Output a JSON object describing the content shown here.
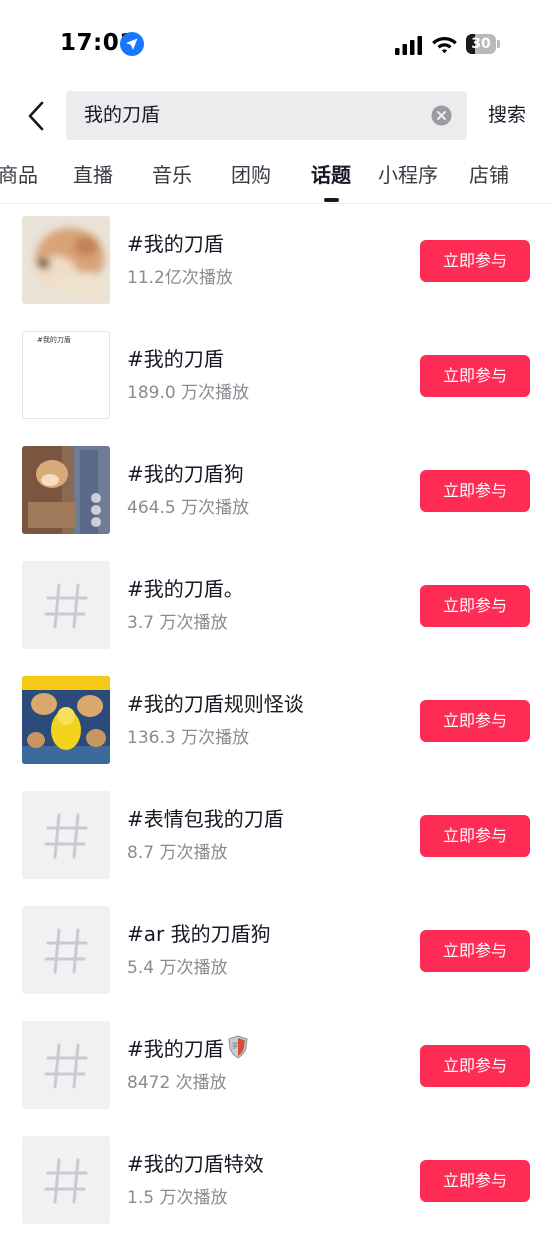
{
  "status_bar": {
    "time": "17:01",
    "battery": "30",
    "battery_level_percent": 30
  },
  "search": {
    "query": "我的刀盾",
    "submit_label": "搜索"
  },
  "tabs": [
    {
      "label": "商品"
    },
    {
      "label": "直播"
    },
    {
      "label": "音乐"
    },
    {
      "label": "团购"
    },
    {
      "label": "话题",
      "active": true
    },
    {
      "label": "小程序"
    },
    {
      "label": "店铺"
    }
  ],
  "topics": [
    {
      "title": "#我的刀盾",
      "plays": "11.2亿次播放",
      "thumb": "doge-blur-image",
      "action": "立即参与"
    },
    {
      "title": "#我的刀盾",
      "plays": "189.0 万次播放",
      "thumb": "blank-text-image",
      "thumb_text": "#我的刀盾",
      "action": "立即参与"
    },
    {
      "title": "#我的刀盾狗",
      "plays": "464.5 万次播放",
      "thumb": "dog-video-still",
      "action": "立即参与"
    },
    {
      "title": "#我的刀盾。",
      "plays": "3.7 万次播放",
      "thumb": "hash-icon",
      "action": "立即参与"
    },
    {
      "title": "#我的刀盾规则怪谈",
      "plays": "136.3 万次播放",
      "thumb": "game-cartoon-image",
      "action": "立即参与"
    },
    {
      "title": "#表情包我的刀盾",
      "plays": "8.7 万次播放",
      "thumb": "hash-icon",
      "action": "立即参与"
    },
    {
      "title": "#ar 我的刀盾狗",
      "plays": "5.4 万次播放",
      "thumb": "hash-icon",
      "action": "立即参与"
    },
    {
      "title": "#我的刀盾",
      "plays": "8472 次播放",
      "thumb": "hash-icon",
      "title_icon": "shield-emoji-icon",
      "action": "立即参与"
    },
    {
      "title": "#我的刀盾特效",
      "plays": "1.5 万次播放",
      "thumb": "hash-icon",
      "action": "立即参与"
    }
  ],
  "colors": {
    "accent": "#fe2c55",
    "primary_text": "#161823",
    "secondary_text": "#8a8b91",
    "search_bg": "#ececee",
    "placeholder_bg": "#f1f1f3"
  }
}
